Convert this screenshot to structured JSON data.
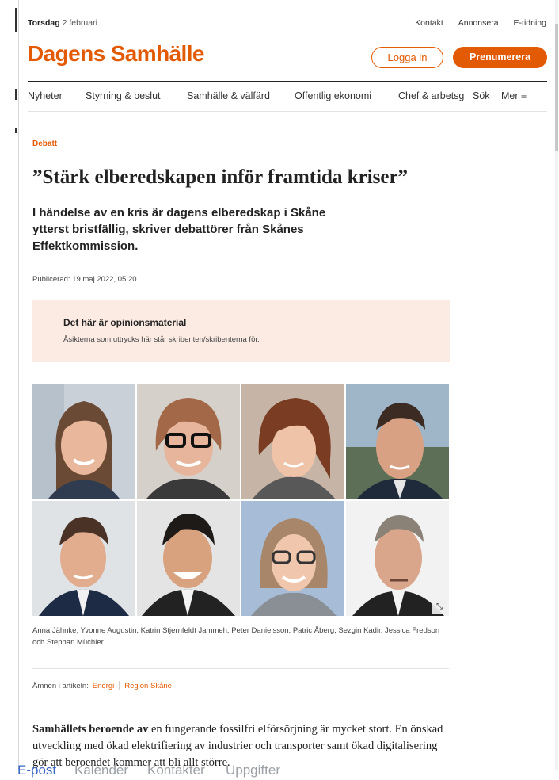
{
  "topbar": {
    "day": "Torsdag",
    "date": "2 februari",
    "links": [
      "Kontakt",
      "Annonsera",
      "E-tidning"
    ]
  },
  "logo": "Dagens Samhälle",
  "auth": {
    "login": "Logga in",
    "subscribe": "Prenumerera"
  },
  "nav": {
    "items": [
      "Nyheter",
      "Styrning & beslut",
      "Samhälle & välfärd",
      "Offentlig ekonomi",
      "Chef & arbetsgivare"
    ],
    "search": "Sök",
    "more": "Mer",
    "more_icon": "≡"
  },
  "article": {
    "kicker": "Debatt",
    "headline": "”Stärk elberedskapen inför framtida kriser”",
    "lead": "I händelse av en kris är dagens elberedskap i Skåne ytterst bristfällig, skriver debattörer från Skånes Effektkommission.",
    "published": "Publicerad: 19 maj 2022, 05:20",
    "opinion_title": "Det här är opinionsmaterial",
    "opinion_text": "Åsikterna som uttrycks här står skribenten/skribenterna för.",
    "caption": "Anna Jähnke, Yvonne Augustin, Katrin Stjernfeldt Jammeh, Peter Danielsson, Patric Åberg, Sezgin Kadir, Jessica Fredson och Stephan Müchler.",
    "topics_label": "Ämnen i artikeln:",
    "topics": [
      "Energi",
      "Region Skåne"
    ],
    "body_bold": "Samhällets beroende av",
    "body_rest": " en fungerande fossilfri elförsörjning är mycket stort. En önskad utveckling med ökad elektrifiering av industrier och transporter samt ökad digitalisering gör att beroendet kommer att bli allt större."
  },
  "bottom_strip": [
    "E-post",
    "Kalender",
    "Kontakter",
    "Uppgifter"
  ],
  "colors": {
    "brand": "#e35a04",
    "opinion_bg": "#fbebe2"
  }
}
